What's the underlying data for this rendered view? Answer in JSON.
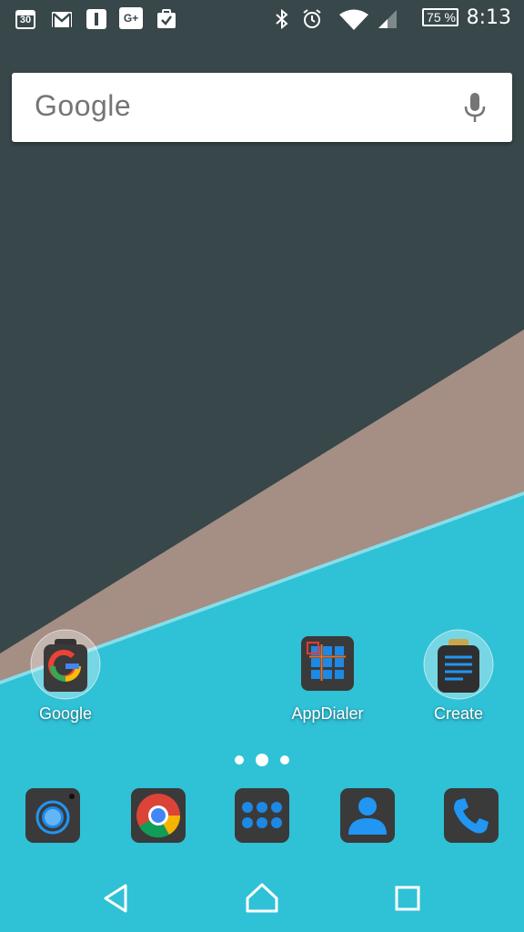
{
  "status_bar": {
    "notifications": [
      "calendar-icon",
      "gmail-icon",
      "instapaper-icon",
      "google-plus-icon",
      "task-icon"
    ],
    "calendar_day": "30",
    "google_plus": "G+",
    "battery_percent": "75 %",
    "clock": "8:13"
  },
  "search_bar": {
    "logo_text": "Google"
  },
  "home_apps": [
    {
      "label": "Google",
      "icon": "google-icon"
    },
    {
      "label": "AppDialer",
      "icon": "appdialer-icon"
    },
    {
      "label": "Create",
      "icon": "create-icon"
    }
  ],
  "page_indicator": {
    "pages": 3,
    "current": 2
  },
  "dock": [
    "camera-icon",
    "chrome-icon",
    "app-drawer-icon",
    "contacts-icon",
    "phone-icon"
  ],
  "nav": [
    "back-icon",
    "home-icon",
    "recents-icon"
  ],
  "colors": {
    "wallpaper_dark": "#37474a",
    "wallpaper_taupe": "#a58e84",
    "wallpaper_cyan": "#2fc1d6",
    "accent_blue": "#2196f3"
  }
}
